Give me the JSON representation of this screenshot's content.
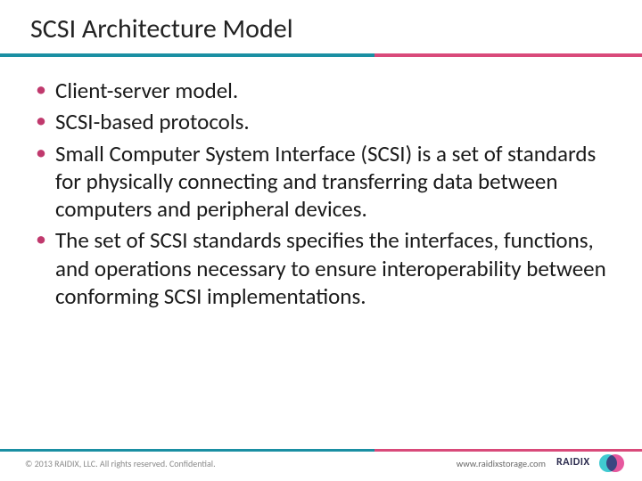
{
  "title": "SCSI Architecture Model",
  "bullets": [
    "Client-server model.",
    "SCSI-based protocols.",
    "Small Computer System Interface (SCSI) is a set of standards for physically connecting and transferring data between computers and peripheral devices.",
    "The set of SCSI standards specifies the interfaces, functions, and operations necessary to ensure interoperability between conforming SCSI implementations."
  ],
  "footer": {
    "copyright": "© 2013 RAIDIX, LLC. All rights reserved. Confidential.",
    "url": "www.raidixstorage.com",
    "logo_text": "RAIDIX"
  }
}
